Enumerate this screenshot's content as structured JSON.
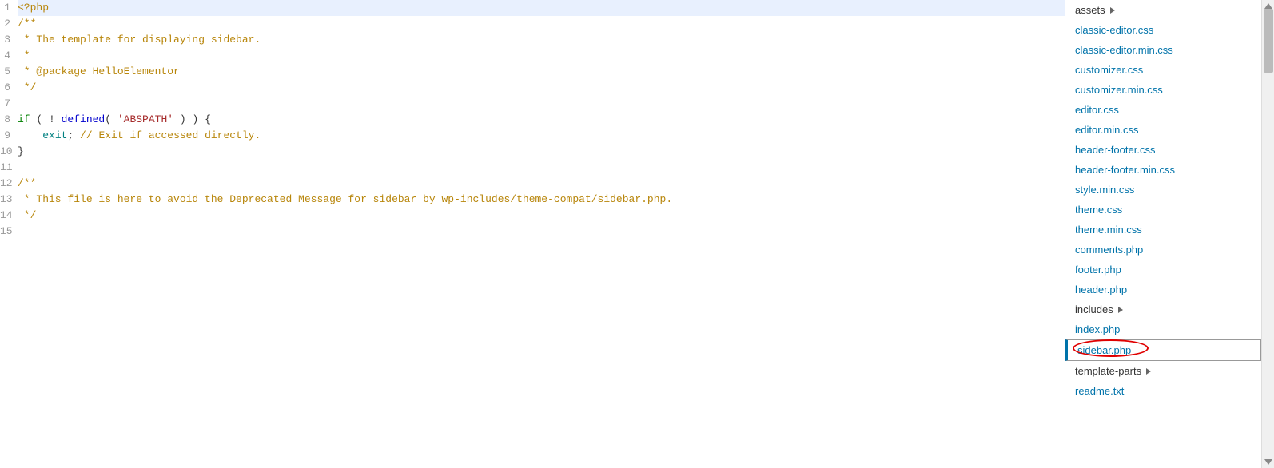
{
  "editor": {
    "lineNumbers": [
      "1",
      "2",
      "3",
      "4",
      "5",
      "6",
      "7",
      "8",
      "9",
      "10",
      "11",
      "12",
      "13",
      "14",
      "15"
    ],
    "activeLine": 0,
    "lines": [
      [
        {
          "t": "<?php",
          "c": "c-tag"
        }
      ],
      [
        {
          "t": "/**",
          "c": "c-comment"
        }
      ],
      [
        {
          "t": " * The template for displaying sidebar.",
          "c": "c-comment"
        }
      ],
      [
        {
          "t": " *",
          "c": "c-comment"
        }
      ],
      [
        {
          "t": " * @package HelloElementor",
          "c": "c-comment"
        }
      ],
      [
        {
          "t": " */",
          "c": "c-comment"
        }
      ],
      [],
      [
        {
          "t": "if",
          "c": "c-keyword"
        },
        {
          "t": " ( ! ",
          "c": "c-punct"
        },
        {
          "t": "defined",
          "c": "c-func"
        },
        {
          "t": "( ",
          "c": "c-punct"
        },
        {
          "t": "'ABSPATH'",
          "c": "c-string"
        },
        {
          "t": " ) ) {",
          "c": "c-punct"
        }
      ],
      [
        {
          "t": "    ",
          "c": ""
        },
        {
          "t": "exit",
          "c": "c-ident"
        },
        {
          "t": "; ",
          "c": "c-punct"
        },
        {
          "t": "// Exit if accessed directly.",
          "c": "c-comment"
        }
      ],
      [
        {
          "t": "}",
          "c": "c-punct"
        }
      ],
      [],
      [
        {
          "t": "/**",
          "c": "c-comment"
        }
      ],
      [
        {
          "t": " * This file is here to avoid the Deprecated Message for sidebar by wp-includes/theme-compat/sidebar.php.",
          "c": "c-comment"
        }
      ],
      [
        {
          "t": " */",
          "c": "c-comment"
        }
      ],
      []
    ]
  },
  "sidebar": {
    "items": [
      {
        "label": "assets",
        "type": "folder",
        "expanded": true
      },
      {
        "label": "classic-editor.css",
        "type": "file"
      },
      {
        "label": "classic-editor.min.css",
        "type": "file"
      },
      {
        "label": "customizer.css",
        "type": "file"
      },
      {
        "label": "customizer.min.css",
        "type": "file"
      },
      {
        "label": "editor.css",
        "type": "file"
      },
      {
        "label": "editor.min.css",
        "type": "file"
      },
      {
        "label": "header-footer.css",
        "type": "file"
      },
      {
        "label": "header-footer.min.css",
        "type": "file"
      },
      {
        "label": "style.min.css",
        "type": "file"
      },
      {
        "label": "theme.css",
        "type": "file"
      },
      {
        "label": "theme.min.css",
        "type": "file"
      },
      {
        "label": "comments.php",
        "type": "file"
      },
      {
        "label": "footer.php",
        "type": "file"
      },
      {
        "label": "header.php",
        "type": "file"
      },
      {
        "label": "includes",
        "type": "folder",
        "expanded": true
      },
      {
        "label": "index.php",
        "type": "file"
      },
      {
        "label": "sidebar.php",
        "type": "file",
        "selected": true,
        "highlighted": true
      },
      {
        "label": "template-parts",
        "type": "folder",
        "expanded": true
      },
      {
        "label": "readme.txt",
        "type": "file"
      }
    ]
  }
}
